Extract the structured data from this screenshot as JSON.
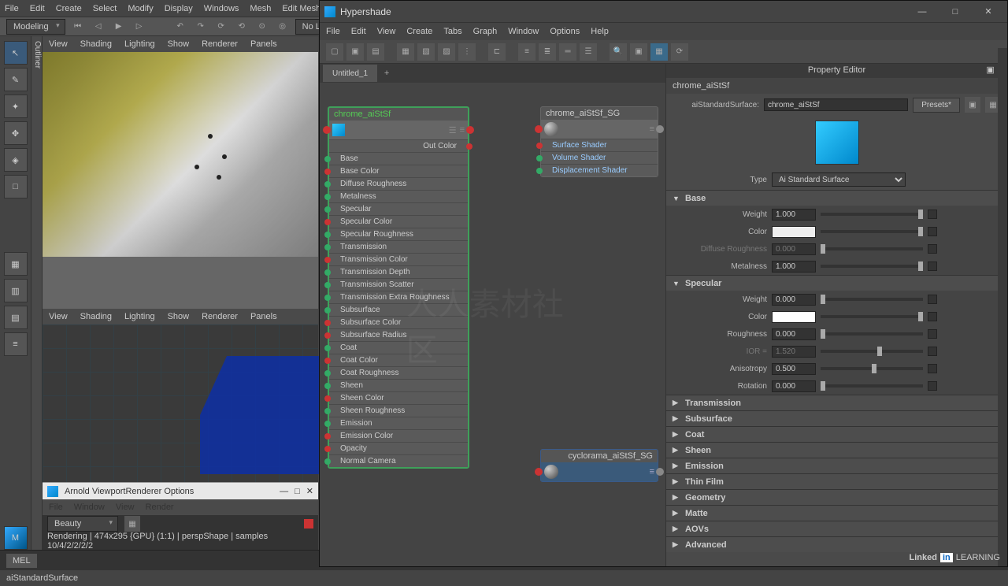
{
  "topMenu": [
    "File",
    "Edit",
    "Create",
    "Select",
    "Modify",
    "Display",
    "Windows",
    "Mesh",
    "Edit Mesh"
  ],
  "shelf": {
    "mode": "Modeling",
    "noLive": "No Live"
  },
  "outlinerLabel": "Outliner",
  "vpMenu": [
    "View",
    "Shading",
    "Lighting",
    "Show",
    "Renderer",
    "Panels"
  ],
  "arnold": {
    "title": "Arnold ViewportRenderer Options",
    "winMenu": [
      "File",
      "Window",
      "View",
      "Render"
    ],
    "beauty": "Beauty",
    "status": "Rendering | 474x295 {GPU} (1:1) | perspShape | samples 10/4/2/2/2/2"
  },
  "mel": "MEL",
  "statusBar": "aiStandardSurface",
  "hypershade": {
    "title": "Hypershade",
    "menu": [
      "File",
      "Edit",
      "View",
      "Create",
      "Tabs",
      "Graph",
      "Window",
      "Options",
      "Help"
    ],
    "tab": "Untitled_1",
    "mainNode": {
      "title": "chrome_aiStSf",
      "outColor": "Out Color",
      "attrs": [
        "Base",
        "Base Color",
        "Diffuse Roughness",
        "Metalness",
        "Specular",
        "Specular Color",
        "Specular Roughness",
        "Transmission",
        "Transmission Color",
        "Transmission Depth",
        "Transmission Scatter",
        "Transmission Extra Roughness",
        "Subsurface",
        "Subsurface Color",
        "Subsurface Radius",
        "Coat",
        "Coat Color",
        "Coat Roughness",
        "Sheen",
        "Sheen Color",
        "Sheen Roughness",
        "Emission",
        "Emission Color",
        "Opacity",
        "Normal Camera"
      ],
      "colorIdx": [
        1,
        5,
        8,
        13,
        14,
        16,
        19,
        22,
        23
      ]
    },
    "sgNode": {
      "title": "chrome_aiStSf_SG",
      "attrs": [
        "Surface Shader",
        "Volume Shader",
        "Displacement Shader"
      ]
    },
    "cycNode": {
      "title": "cyclorama_aiStSf_SG"
    }
  },
  "propEditor": {
    "title": "Property Editor",
    "nodeName": "chrome_aiStSf",
    "surfLabel": "aiStandardSurface:",
    "surfName": "chrome_aiStSf",
    "presets": "Presets*",
    "typeLabel": "Type",
    "typeValue": "Ai Standard Surface",
    "sections": {
      "base": {
        "title": "Base",
        "weight": "1.000",
        "color": "#eeeeee",
        "diffRough": "0.000",
        "metal": "1.000"
      },
      "spec": {
        "title": "Specular",
        "weight": "0.000",
        "color": "#ffffff",
        "rough": "0.000",
        "ior": "1.520",
        "aniso": "0.500",
        "rot": "0.000"
      },
      "closed": [
        "Transmission",
        "Subsurface",
        "Coat",
        "Sheen",
        "Emission",
        "Thin Film",
        "Geometry",
        "Matte",
        "AOVs",
        "Advanced"
      ]
    },
    "labels": {
      "weight": "Weight",
      "color": "Color",
      "diffRough": "Diffuse Roughness",
      "metal": "Metalness",
      "rough": "Roughness",
      "ior": "IOR  =",
      "aniso": "Anisotropy",
      "rot": "Rotation"
    }
  },
  "linkedin": {
    "brand": "Linked",
    "box": "in",
    "learn": "LEARNING"
  },
  "watermark": "人人素材社区"
}
